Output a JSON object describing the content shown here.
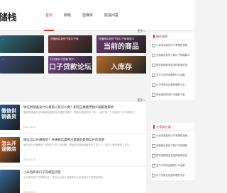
{
  "header": {
    "logo": "储栈",
    "nav": [
      "首页",
      "网络",
      "自媒体",
      "财富问答"
    ]
  },
  "left": {
    "more_label_1": "更多 >",
    "more_label_2": "更多 >",
    "tiles": [
      {
        "caption": "...",
        "big": "",
        "color": "#2b6a7a"
      },
      {
        "caption": "充值网店如何下架口子商",
        "big": "",
        "color": "#7a3a3a"
      },
      {
        "caption": "充值网店如何下架口子商城新口",
        "big": "当前的商品",
        "color": "#6b3a6e"
      },
      {
        "caption": "...",
        "big": "",
        "color": "#3a4a6e"
      },
      {
        "caption": "口子类口子贷款 黑户...",
        "big": "口子贷款论坛",
        "color": "#7c4a8a"
      },
      {
        "caption": "...",
        "big": "入库存",
        "color": "#b06a2a"
      }
    ],
    "articles": [
      {
        "title": "微信供销备货什么意思以及怎么做？如何正确使用防诈骗套路解析",
        "desc": "微信供销备货也叫做朋友圈微商代理进货模式，是新手最常见的一种，一起了解一下微商的一件代发模式，",
        "time": "2020-03-03",
        "thumb_text": "微信供销备货",
        "thumb_color": "#2b5a8a"
      },
      {
        "title": "微信怎么开通微店？开通微信需要注意哪些是微信开店说明",
        "desc": "微店怎么开通微信？是很多人关心的问题，微信是目前使用最多的工具之一，更多人都在微信上开店。",
        "time": "2020-03-03",
        "thumb_text": "怎么开通微店",
        "thumb_color": "#c8652a"
      },
      {
        "title": "小米电商商口子有哪些贷款",
        "desc": "小米电商商口子贷款分析，本文为大家介绍具体的小米商城口子有哪些贷款。",
        "time": "2020-03-03",
        "thumb_text": "",
        "thumb_color": "#3a6a9a"
      }
    ]
  },
  "right": {
    "panel1": {
      "title": "精彩推荐",
      "items": [
        "小米电商如何口子有哪些贷款",
        "充值网店如何下架口子商城新口",
        "网贷逾期到底会怎样影响征信",
        "支付人网贷逾期有什么后果",
        "口子贷款论坛都有哪些平台",
        "好信用网贷到口子最新下款"
      ]
    },
    "panel2": {
      "title": "大家都在看",
      "items": [
        "小米电商如何口子有哪些贷款",
        "充值网店如何下架口子商城新",
        "网贷逾期到底会怎样影响征信",
        "支付人网贷逾期有什么后果",
        "口子贷款论坛都有哪些平台"
      ]
    }
  }
}
